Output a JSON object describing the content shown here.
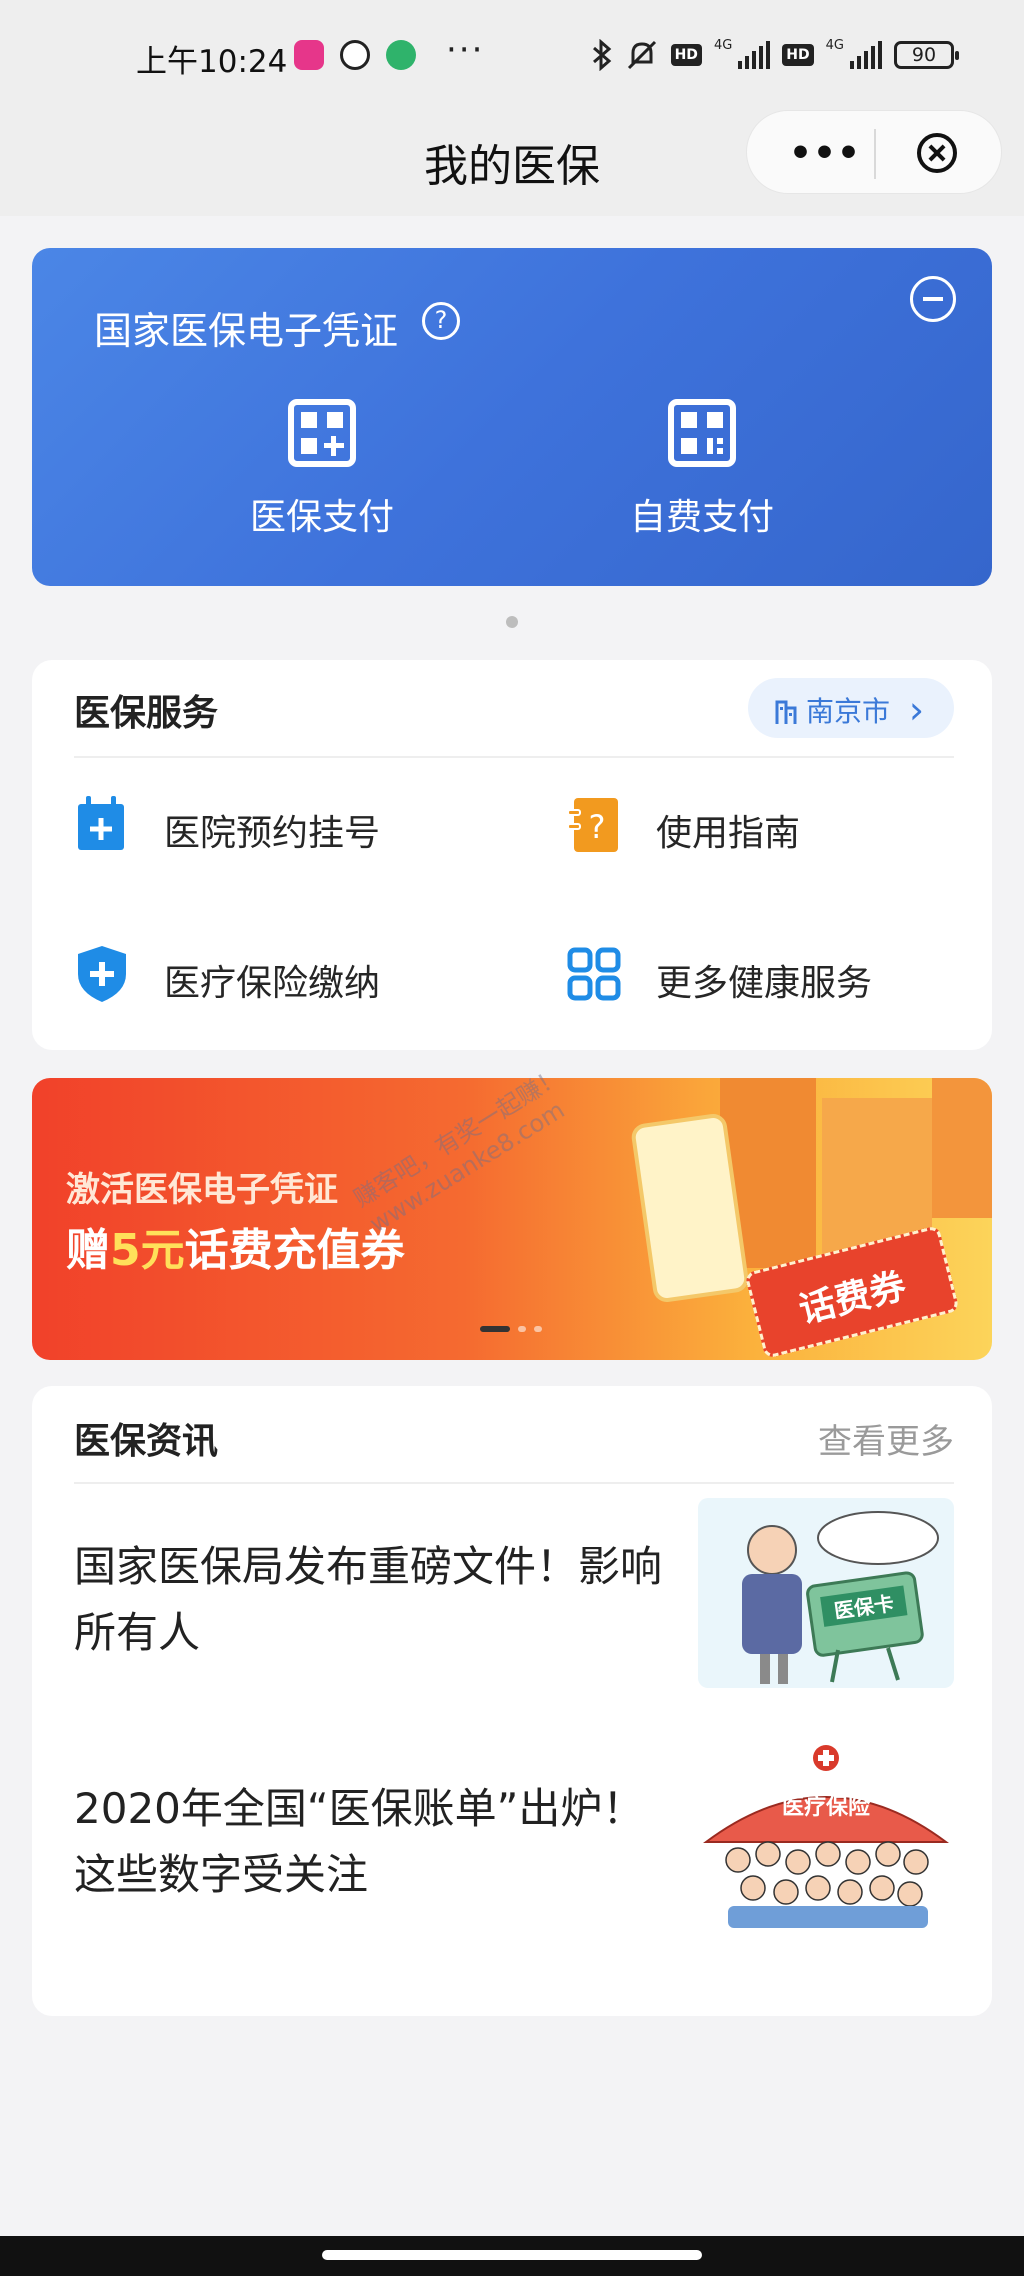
{
  "status_bar": {
    "time": "上午10:24",
    "dots": "···",
    "hd": "HD",
    "net": "4G",
    "battery": "90"
  },
  "nav": {
    "title": "我的医保",
    "more_icon": "more-dots-icon",
    "close_icon": "close-circle-icon"
  },
  "certificate": {
    "title": "国家医保电子凭证",
    "help": "?",
    "pay_medical": "医保支付",
    "pay_self": "自费支付",
    "colors": {
      "card_start": "#4b86e6",
      "card_end": "#3566cc"
    }
  },
  "service": {
    "title": "医保服务",
    "city": "南京市",
    "city_chevron": "›",
    "items": [
      {
        "label": "医院预约挂号",
        "icon": "calendar-plus-icon",
        "color": "#1f8ce6"
      },
      {
        "label": "使用指南",
        "icon": "guide-question-icon",
        "color": "#f29a1f"
      },
      {
        "label": "医疗保险缴纳",
        "icon": "shield-plus-icon",
        "color": "#1f8ce6"
      },
      {
        "label": "更多健康服务",
        "icon": "grid-apps-icon",
        "color": "#1f8ce6"
      }
    ]
  },
  "banner": {
    "line1": "激活医保电子凭证",
    "line2_pre": "赠",
    "line2_highlight": "5元",
    "line2_post": "话费充值券",
    "coupon": "话费券",
    "watermark_1": "赚客吧，有奖一起赚！",
    "watermark_2": "www.zuanke8.com",
    "active_slide": 1,
    "slide_count": 3
  },
  "news": {
    "title": "医保资讯",
    "more": "查看更多",
    "items": [
      {
        "text": "国家医保局发布重磅文件！影响所有人",
        "thumb_label": "医保卡"
      },
      {
        "text": "2020年全国“医保账单”出炉！这些数字受关注",
        "thumb_label": "医疗保险"
      }
    ]
  }
}
